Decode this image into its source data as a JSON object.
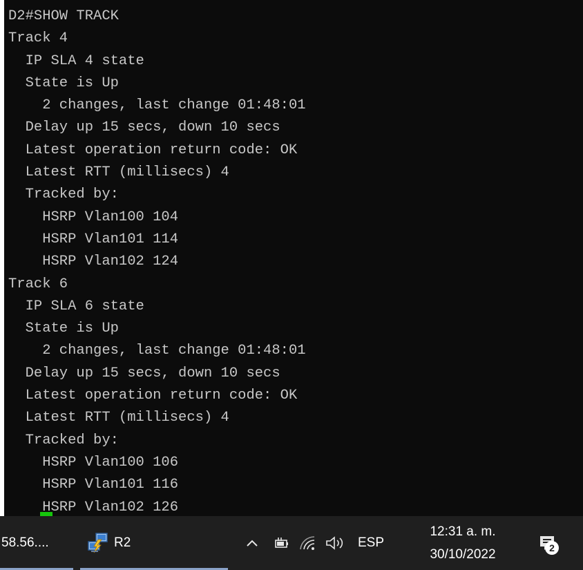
{
  "terminal": {
    "lines": [
      "D2#SHOW TRACK",
      "Track 4",
      "  IP SLA 4 state",
      "  State is Up",
      "    2 changes, last change 01:48:01",
      "  Delay up 15 secs, down 10 secs",
      "  Latest operation return code: OK",
      "  Latest RTT (millisecs) 4",
      "  Tracked by:",
      "    HSRP Vlan100 104",
      "    HSRP Vlan101 114",
      "    HSRP Vlan102 124",
      "Track 6",
      "  IP SLA 6 state",
      "  State is Up",
      "    2 changes, last change 01:48:01",
      "  Delay up 15 secs, down 10 secs",
      "  Latest operation return code: OK",
      "  Latest RTT (millisecs) 4",
      "  Tracked by:",
      "    HSRP Vlan100 106",
      "    HSRP Vlan101 116",
      "    HSRP Vlan102 126"
    ]
  },
  "taskbar": {
    "partial_app_label": "58.56....",
    "active_app_label": "R2",
    "active_app_icon": "network-computers-icon",
    "tray": {
      "overflow_icon": "chevron-up-icon",
      "power_icon": "battery-plug-icon",
      "network_icon": "wifi-icon",
      "volume_icon": "speaker-icon",
      "language": "ESP"
    },
    "clock": {
      "time": "12:31 a. m.",
      "date": "30/10/2022"
    },
    "notifications": {
      "icon": "notification-icon",
      "count": "2"
    }
  },
  "colors": {
    "terminal_bg": "#0c0c0c",
    "terminal_text": "#c8c8c8",
    "cursor": "#16c60c",
    "taskbar_bg": "#1f1f1f",
    "taskbar_text": "#ffffff"
  }
}
